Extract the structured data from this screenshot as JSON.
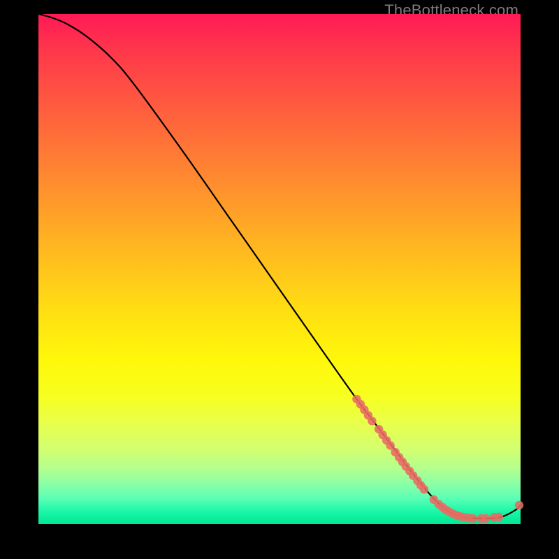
{
  "watermark": "TheBottleneck.com",
  "colors": {
    "background": "#000000",
    "curve": "#000000",
    "dot_fill": "#e86b63",
    "dot_stroke": "#e86b63"
  },
  "chart_data": {
    "type": "line",
    "title": "",
    "xlabel": "",
    "ylabel": "",
    "xlim": [
      0,
      100
    ],
    "ylim": [
      0,
      100
    ],
    "note": "Values are read as percentages of plot area; x left→right, y bottom→top. Curve descends from top-left to a flat minimum near the right, with a small uptick at the far right. Dots mark sampled points along the lower-right portion.",
    "curve": [
      {
        "x": 0,
        "y": 100.0
      },
      {
        "x": 3,
        "y": 99.2
      },
      {
        "x": 6,
        "y": 98.0
      },
      {
        "x": 10,
        "y": 95.6
      },
      {
        "x": 15,
        "y": 91.5
      },
      {
        "x": 20,
        "y": 86.0
      },
      {
        "x": 30,
        "y": 73.0
      },
      {
        "x": 40,
        "y": 59.5
      },
      {
        "x": 50,
        "y": 46.0
      },
      {
        "x": 60,
        "y": 32.5
      },
      {
        "x": 66,
        "y": 24.5
      },
      {
        "x": 70,
        "y": 19.5
      },
      {
        "x": 74,
        "y": 14.5
      },
      {
        "x": 78,
        "y": 9.5
      },
      {
        "x": 82,
        "y": 5.0
      },
      {
        "x": 85,
        "y": 2.6
      },
      {
        "x": 88,
        "y": 1.4
      },
      {
        "x": 92,
        "y": 1.1
      },
      {
        "x": 96,
        "y": 1.4
      },
      {
        "x": 99,
        "y": 2.8
      },
      {
        "x": 100,
        "y": 3.8
      }
    ],
    "dots": [
      {
        "x": 66.0,
        "y": 24.5
      },
      {
        "x": 66.8,
        "y": 23.5
      },
      {
        "x": 67.6,
        "y": 22.4
      },
      {
        "x": 68.4,
        "y": 21.3
      },
      {
        "x": 69.2,
        "y": 20.2
      },
      {
        "x": 70.6,
        "y": 18.6
      },
      {
        "x": 71.4,
        "y": 17.5
      },
      {
        "x": 72.2,
        "y": 16.4
      },
      {
        "x": 73.0,
        "y": 15.4
      },
      {
        "x": 74.0,
        "y": 14.1
      },
      {
        "x": 74.8,
        "y": 13.1
      },
      {
        "x": 75.5,
        "y": 12.2
      },
      {
        "x": 76.2,
        "y": 11.3
      },
      {
        "x": 77.0,
        "y": 10.4
      },
      {
        "x": 77.7,
        "y": 9.5
      },
      {
        "x": 78.6,
        "y": 8.5
      },
      {
        "x": 79.3,
        "y": 7.6
      },
      {
        "x": 80.0,
        "y": 6.8
      },
      {
        "x": 82.0,
        "y": 4.8
      },
      {
        "x": 83.0,
        "y": 3.9
      },
      {
        "x": 83.8,
        "y": 3.3
      },
      {
        "x": 84.5,
        "y": 2.8
      },
      {
        "x": 85.2,
        "y": 2.4
      },
      {
        "x": 86.0,
        "y": 2.0
      },
      {
        "x": 86.8,
        "y": 1.7
      },
      {
        "x": 87.5,
        "y": 1.5
      },
      {
        "x": 88.3,
        "y": 1.3
      },
      {
        "x": 89.2,
        "y": 1.2
      },
      {
        "x": 90.1,
        "y": 1.1
      },
      {
        "x": 91.8,
        "y": 1.1
      },
      {
        "x": 92.8,
        "y": 1.1
      },
      {
        "x": 94.5,
        "y": 1.3
      },
      {
        "x": 95.5,
        "y": 1.4
      },
      {
        "x": 99.7,
        "y": 3.7
      }
    ]
  }
}
